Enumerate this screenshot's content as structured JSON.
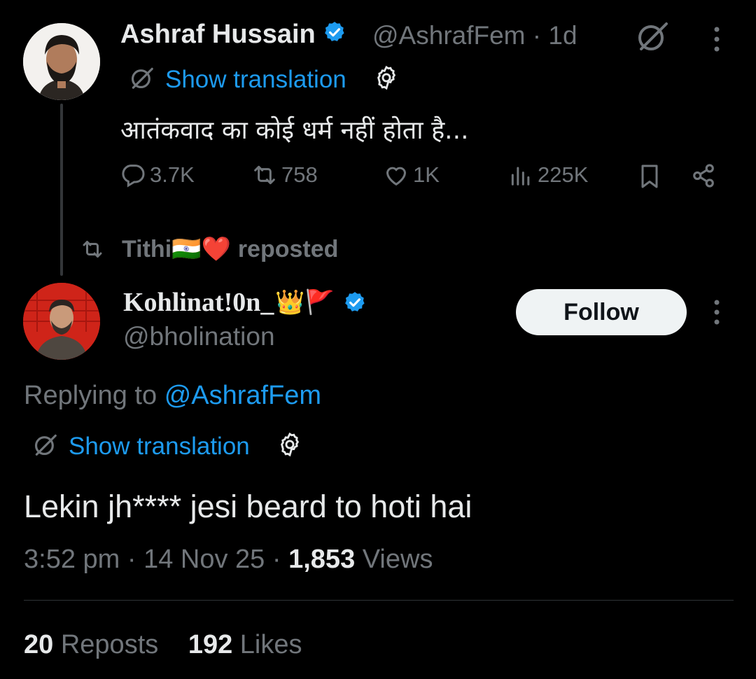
{
  "parent_tweet": {
    "author_name": "Ashraf Hussain",
    "handle": "@AshrafFem",
    "time": "· 1d",
    "show_translation": "Show translation",
    "text": "आतंकवाद का कोई धर्म नहीं होता है...",
    "replies": "3.7K",
    "reposts": "758",
    "likes": "1K",
    "views": "225K"
  },
  "repost_banner": {
    "name": "Tithi🇮🇳❤️",
    "label": "reposted"
  },
  "main_tweet": {
    "author_name": "Kohlinat!0n_",
    "author_emojis": "👑🚩",
    "handle": "@bholination",
    "follow_label": "Follow",
    "replying_prefix": "Replying to",
    "replying_handle": "@AshrafFem",
    "show_translation": "Show translation",
    "text": "Lekin jh**** jesi beard to hoti hai",
    "time": "3:52 pm",
    "date": "14 Nov 25",
    "views_count": "1,853",
    "views_label": "Views",
    "sep1": "·",
    "sep2": "·"
  },
  "engagement": {
    "reposts_count": "20",
    "reposts_label": "Reposts",
    "likes_count": "192",
    "likes_label": "Likes"
  },
  "colors": {
    "background": "#000000",
    "text": "#e7e9ea",
    "muted": "#71767b",
    "accent": "#1d9bf0",
    "follow_bg": "#eff3f4"
  },
  "icons": [
    "verified-badge-icon",
    "grok-icon",
    "more-icon",
    "translate-icon",
    "gear-icon",
    "reply-icon",
    "repost-icon",
    "like-icon",
    "views-icon",
    "bookmark-icon",
    "share-icon"
  ]
}
